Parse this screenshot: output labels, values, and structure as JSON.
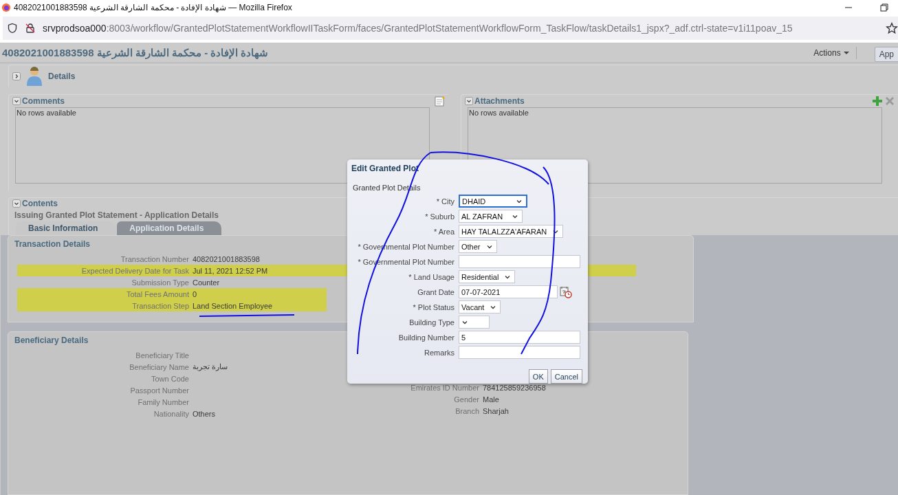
{
  "browser": {
    "title": "4082021001883598 شهادة الإفادة - محكمة الشارقة الشرعية — Mozilla Firefox",
    "url_host": "srvprodsoa000",
    "url_rest": ":8003/workflow/GrantedPlotStatementWorkflowIITaskForm/faces/GrantedPlotStatementWorkflowForm_TaskFlow/taskDetails1_jspx?_adf.ctrl-state=v1i11poav_15"
  },
  "header": {
    "title": "4082021001883598 شهادة الإفادة - محكمة الشارقة الشرعية",
    "actions": "Actions",
    "button": "App"
  },
  "details": {
    "label": "Details",
    "expanded": false
  },
  "panels": [
    {
      "title": "Comments",
      "expanded": true,
      "empty_text": "No rows available"
    },
    {
      "title": "Attachments",
      "expanded": true,
      "empty_text": "No rows available"
    }
  ],
  "contents": {
    "title": "Contents",
    "expanded": true,
    "subtitle": "Issuing Granted Plot Statement - Application Details",
    "tabs": [
      {
        "label": "Basic Information",
        "selected": true
      },
      {
        "label": "Application Details",
        "selected": false
      }
    ],
    "transaction": {
      "title": "Transaction Details",
      "rows": [
        {
          "label": "Transaction Number",
          "value": "4082021001883598",
          "highlighted": false,
          "right_highlighted": false
        },
        {
          "label": "Expected Delivery Date for Task",
          "value": "Jul 11, 2021 12:52 PM",
          "highlighted": true,
          "right_highlighted": true
        },
        {
          "label": "Submission Type",
          "value": "Counter",
          "highlighted": false,
          "right_highlighted": false
        },
        {
          "label": "Total Fees Amount",
          "value": "0",
          "highlighted": true,
          "right_highlighted": false
        },
        {
          "label": "Transaction Step",
          "value": "Land Section Employee",
          "highlighted": true,
          "right_highlighted": false
        }
      ]
    },
    "beneficiary": {
      "title": "Beneficiary Details",
      "left": [
        {
          "label": "Beneficiary Title"
        },
        {
          "label": "Beneficiary Name",
          "value": "سارة تجربة"
        },
        {
          "label": "Town Code"
        },
        {
          "label": "Passport Number"
        },
        {
          "label": "Family Number"
        },
        {
          "label": "Nationality",
          "value": "Others"
        }
      ],
      "right": [
        {
          "label": "Emirates ID Number",
          "value": "784125859236958"
        },
        {
          "label": "Gender",
          "value": "Male"
        },
        {
          "label": "Branch",
          "value": "Sharjah"
        }
      ]
    }
  },
  "dialog": {
    "title": "Edit Granted Plot",
    "section": "Granted Plot Details",
    "fields": [
      {
        "label": "* City",
        "kind": "select",
        "value": "DHAID",
        "focused": true
      },
      {
        "label": "* Suburb",
        "kind": "select",
        "value": "AL ZAFRAN",
        "focused": false
      },
      {
        "label": "* Area",
        "kind": "select",
        "value": "HAY TALALZZA'AFARAN",
        "focused": false
      },
      {
        "label": "* Governmental Plot Number",
        "kind": "select",
        "value": "Other",
        "focused": false
      },
      {
        "label": "* Governmental Plot Number",
        "kind": "text",
        "focused": false
      },
      {
        "label": "* Land Usage",
        "kind": "select",
        "value": "Residential",
        "focused": false
      },
      {
        "label": "Grant Date",
        "kind": "date",
        "value": "07-07-2021",
        "focused": false
      },
      {
        "label": "* Plot Status",
        "kind": "select",
        "value": "Vacant",
        "focused": false
      },
      {
        "label": "Building Type",
        "kind": "select",
        "focused": false
      },
      {
        "label": "Building Number",
        "kind": "text",
        "value": "5",
        "focused": false
      },
      {
        "label": "Remarks",
        "kind": "text",
        "focused": false
      }
    ],
    "buttons": [
      "OK",
      "Cancel"
    ]
  }
}
